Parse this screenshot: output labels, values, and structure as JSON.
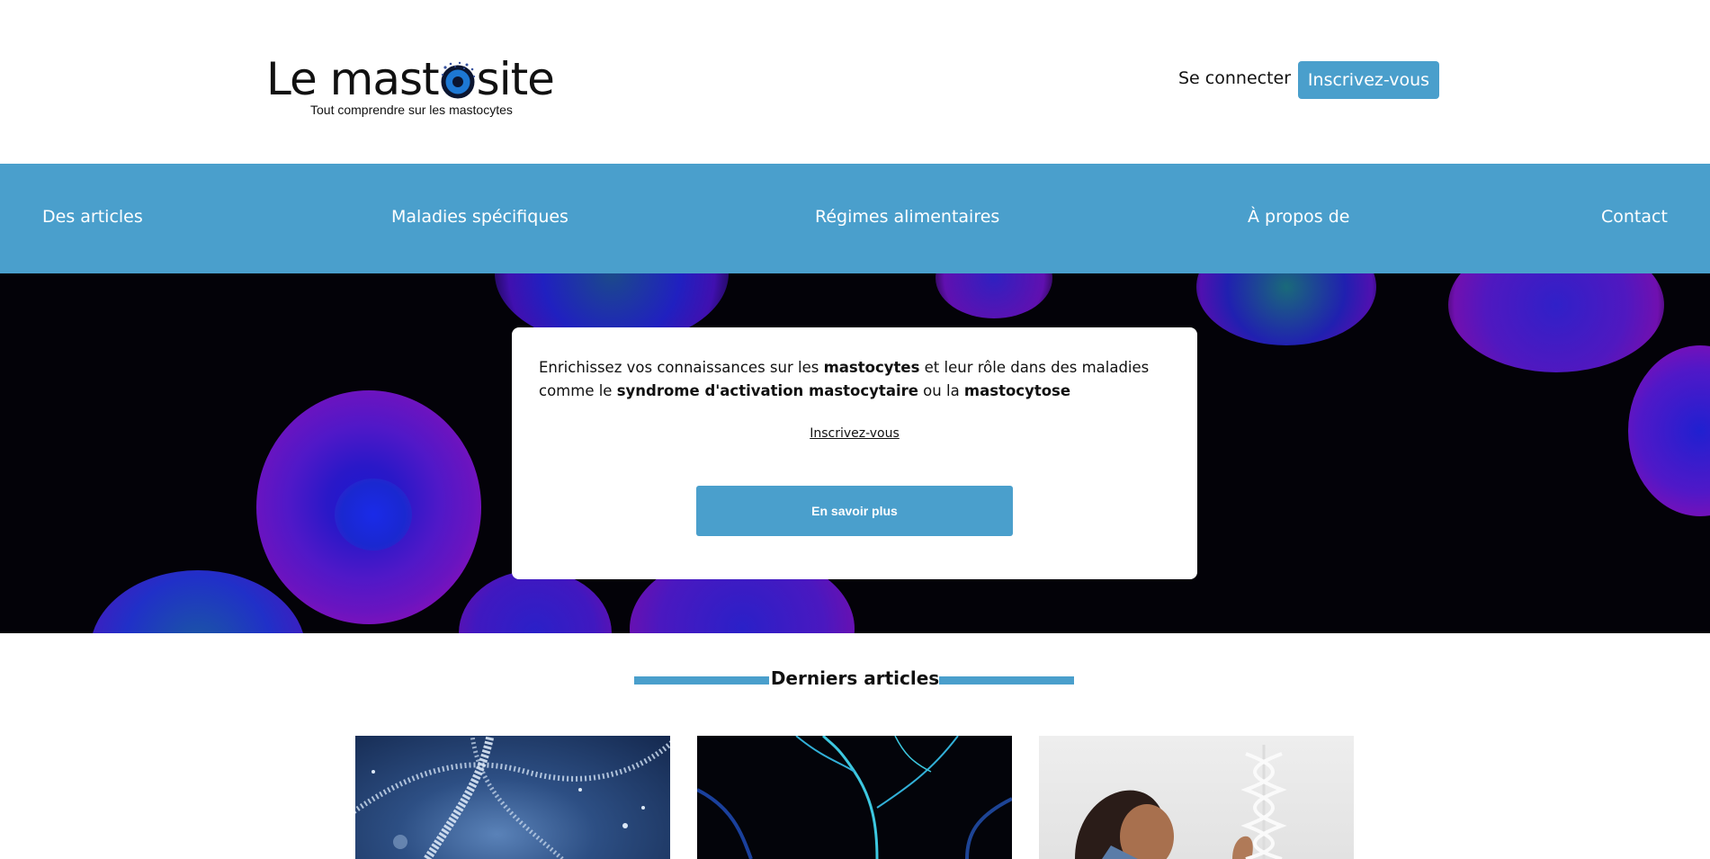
{
  "header": {
    "logo_text_before": "Le mast",
    "logo_text_after": "site",
    "logo_tagline": "Tout comprendre sur les mastocytes",
    "login_label": "Se connecter",
    "signup_label": "Inscrivez-vous"
  },
  "nav": {
    "items": [
      {
        "label": "Des articles"
      },
      {
        "label": "Maladies spécifiques"
      },
      {
        "label": "Régimes alimentaires"
      },
      {
        "label": "À propos de"
      },
      {
        "label": "Contact"
      }
    ]
  },
  "hero": {
    "text_1": "Enrichissez vos connaissances sur les ",
    "bold_1": "mastocytes",
    "text_2": " et leur rôle dans des maladies comme le ",
    "bold_2": "syndrome d'activation mastocytaire",
    "text_3": " ou la ",
    "bold_3": "mastocytose",
    "link_label": "Inscrivez-vous",
    "button_label": "En savoir plus"
  },
  "latest": {
    "title": "Derniers articles",
    "articles": [
      {
        "image": "dna-helix-image"
      },
      {
        "image": "neuron-branches-image"
      },
      {
        "image": "woman-with-dna-model-image"
      }
    ]
  },
  "colors": {
    "accent": "#4a9fcc",
    "hero_bg": "#030208",
    "text": "#111111"
  }
}
